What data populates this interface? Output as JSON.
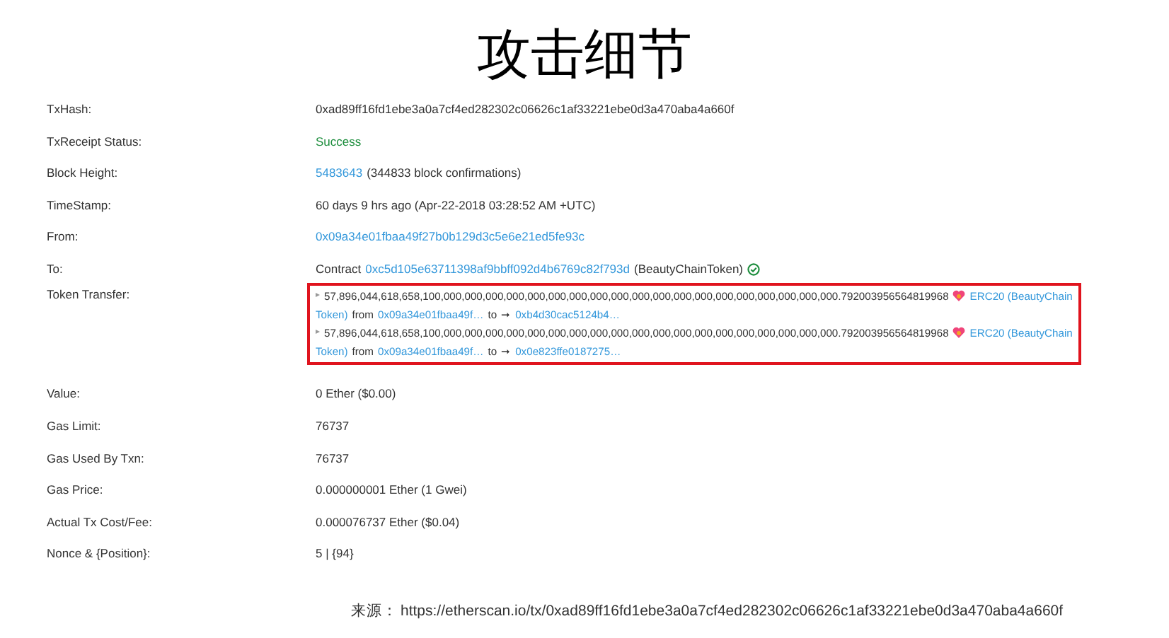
{
  "title": "攻击细节",
  "rows": [
    {
      "label": "TxHash:",
      "value": [
        {
          "kind": "text",
          "text": "0xad89ff16fd1ebe3a0a7cf4ed282302c06626c1af33221ebe0d3a470aba4a660f"
        }
      ]
    },
    {
      "label": "TxReceipt Status:",
      "value": [
        {
          "kind": "success",
          "text": "Success"
        }
      ]
    },
    {
      "label": "Block Height:",
      "value": [
        {
          "kind": "link",
          "text": "5483643"
        },
        {
          "kind": "text",
          "text": "(344833 block confirmations)"
        }
      ]
    },
    {
      "label": "TimeStamp:",
      "value": [
        {
          "kind": "text",
          "text": "60 days 9 hrs ago (Apr-22-2018 03:28:52 AM +UTC)"
        }
      ]
    },
    {
      "label": "From:",
      "value": [
        {
          "kind": "link",
          "text": "0x09a34e01fbaa49f27b0b129d3c5e6e21ed5fe93c"
        }
      ]
    },
    {
      "label": "To:",
      "value": [
        {
          "kind": "text",
          "text": "Contract"
        },
        {
          "kind": "link",
          "text": "0xc5d105e63711398af9bbff092d4b6769c82f793d"
        },
        {
          "kind": "text",
          "text": "(BeautyChainToken)"
        },
        {
          "kind": "check"
        }
      ]
    },
    {
      "label": "Token Transfer:",
      "kind": "transfers",
      "transfers": [
        {
          "marker": "▸",
          "amount": "57,896,044,618,658,100,000,000,000,000,000,000,000,000,000,000,000,000,000,000,000,000,000,000,000.792003956564819968",
          "token": [
            "ERC20 (BeautyChain",
            "Token)"
          ],
          "from_label": "from",
          "from": "0x09a34e01fbaa49f…",
          "to_label": "to",
          "arrow": "➞",
          "to": "0xb4d30cac5124b4…"
        },
        {
          "marker": "▸",
          "amount": "57,896,044,618,658,100,000,000,000,000,000,000,000,000,000,000,000,000,000,000,000,000,000,000,000.792003956564819968",
          "token": [
            "ERC20 (BeautyChain",
            "Token)"
          ],
          "from_label": "from",
          "from": "0x09a34e01fbaa49f…",
          "to_label": "to",
          "arrow": "➞",
          "to": "0x0e823ffe0187275…"
        }
      ]
    },
    {
      "label": "Value:",
      "value": [
        {
          "kind": "text",
          "text": "0 Ether ($0.00)"
        }
      ]
    },
    {
      "label": "Gas Limit:",
      "value": [
        {
          "kind": "text",
          "text": "76737"
        }
      ]
    },
    {
      "label": "Gas Used By Txn:",
      "value": [
        {
          "kind": "text",
          "text": "76737"
        }
      ]
    },
    {
      "label": "Gas Price:",
      "value": [
        {
          "kind": "text",
          "text": "0.000000001 Ether (1 Gwei)"
        }
      ]
    },
    {
      "label": "Actual Tx Cost/Fee:",
      "value": [
        {
          "kind": "text",
          "text": "0.000076737 Ether ($0.04)"
        }
      ]
    },
    {
      "label": "Nonce & {Position}:",
      "value": [
        {
          "kind": "text",
          "text": "5 | {94}"
        }
      ]
    }
  ],
  "source": {
    "label": "来源：",
    "url": "https://etherscan.io/tx/0xad89ff16fd1ebe3a0a7cf4ed282302c06626c1af33221ebe0d3a470aba4a660f"
  }
}
